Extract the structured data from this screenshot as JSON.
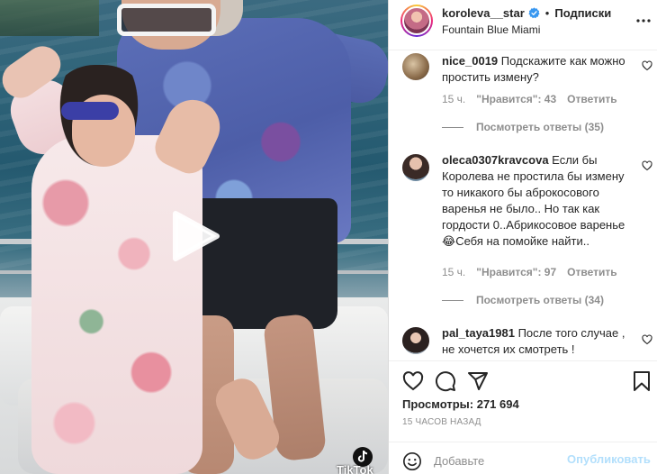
{
  "post": {
    "username": "koroleva__star",
    "separator": "•",
    "follow_status": "Подписки",
    "location": "Fountain Blue Miami",
    "views_label": "Просмотры:",
    "views_count": "271 694",
    "posted_ago": "15 часов назад",
    "video_watermark": "TikTok"
  },
  "comments": [
    {
      "username": "nice_0019",
      "text": "Подскажите как можно простить измену?",
      "time": "15 ч.",
      "likes": "\"Нравится\": 43",
      "reply_label": "Ответить",
      "view_replies": "Посмотреть ответы (35)"
    },
    {
      "username": "oleca0307kravcova",
      "text": "Если бы Королева не простила бы измену то никакого бы аброкосового варенья не было.. Но так как гордости 0..Абрикосовое варенье😂Себя на помойке найти..",
      "time": "15 ч.",
      "likes": "\"Нравится\": 97",
      "reply_label": "Ответить",
      "view_replies": "Посмотреть ответы (34)"
    },
    {
      "username": "pal_taya1981",
      "text": "После того случае , не хочется их смотреть !",
      "time": "",
      "likes": "",
      "reply_label": "",
      "view_replies": ""
    }
  ],
  "comment_box": {
    "placeholder": "Добавьте",
    "publish_label": "Опубликовать"
  },
  "colors": {
    "text": "#262626",
    "secondary": "#8e8e8e",
    "link_disabled": "#b2dffc",
    "verified": "#3897f0"
  },
  "icons": [
    "more-icon",
    "verified-icon",
    "heart-icon",
    "comment-icon",
    "share-icon",
    "bookmark-icon",
    "emoji-icon",
    "play-icon",
    "tiktok-icon"
  ]
}
